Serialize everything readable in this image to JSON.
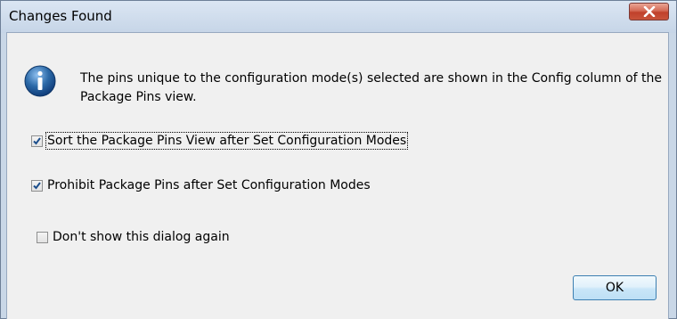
{
  "window": {
    "title": "Changes Found"
  },
  "message": {
    "icon": "info-icon",
    "text": "The pins unique to the configuration mode(s) selected are shown in the Config column of the Package Pins view."
  },
  "options": [
    {
      "label": "Sort the Package Pins View after Set Configuration Modes",
      "checked": true
    },
    {
      "label": "Prohibit Package Pins after Set Configuration Modes",
      "checked": true
    },
    {
      "label": "Don't show this dialog again",
      "checked": false
    }
  ],
  "buttons": {
    "ok_label": "OK"
  },
  "colors": {
    "accent": "#2c6aa8",
    "close_button": "#c9543b",
    "dialog_bg": "#f0f0f0",
    "frame": "#c9d7e7"
  }
}
